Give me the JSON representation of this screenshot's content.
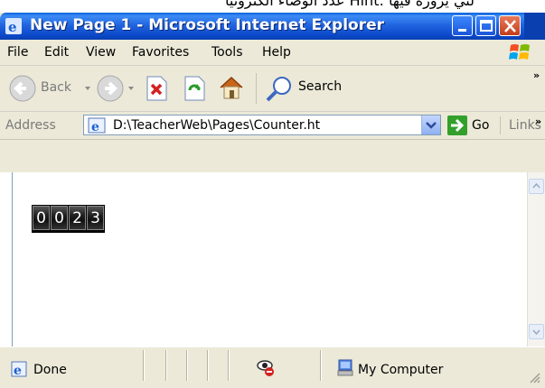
{
  "page_caption": "لتي يزوره فيها :Hint عدد الوصاء الكترونيا",
  "window": {
    "title": "New Page 1 - Microsoft Internet Explorer"
  },
  "menu": {
    "items": [
      "File",
      "Edit",
      "View",
      "Favorites",
      "Tools",
      "Help"
    ]
  },
  "toolbar": {
    "back_label": "Back",
    "search_label": "Search"
  },
  "address": {
    "label": "Address",
    "value": "D:\\TeacherWeb\\Pages\\Counter.ht",
    "go_label": "Go",
    "links_label": "Links"
  },
  "counter": {
    "digits": [
      "0",
      "0",
      "2",
      "3"
    ]
  },
  "status": {
    "done_label": "Done",
    "zone_label": "My Computer"
  },
  "colors": {
    "titlebar": "#2265e0",
    "chrome": "#ece9d8"
  }
}
